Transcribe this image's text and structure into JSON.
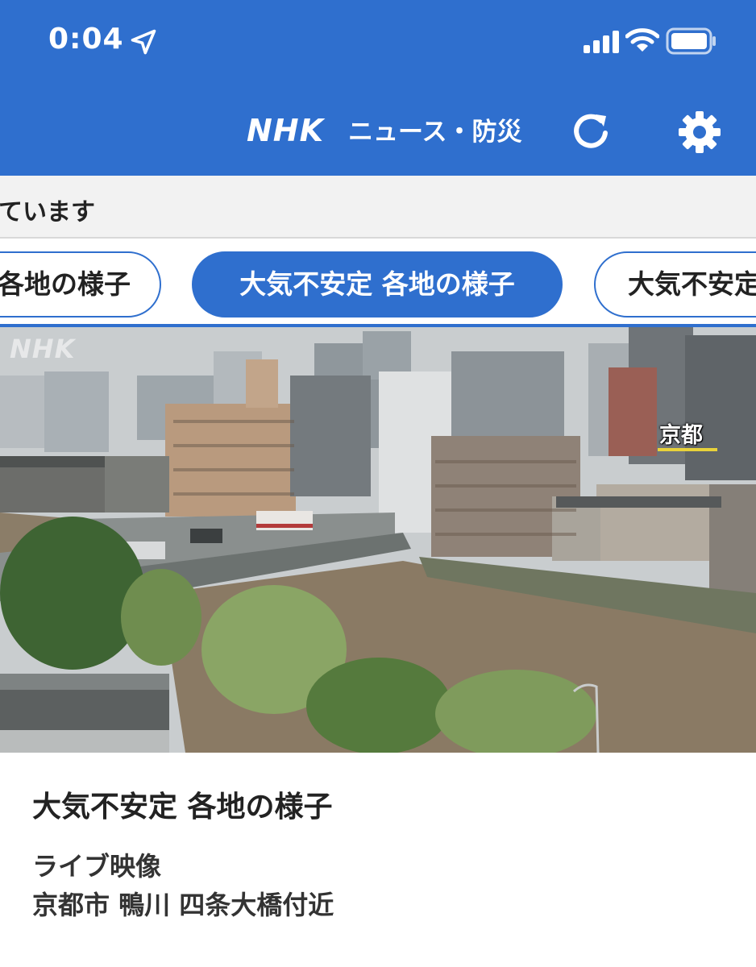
{
  "status_bar": {
    "time": "0:04",
    "icons": [
      "location-arrow-icon",
      "cellular-signal-icon",
      "wifi-icon",
      "battery-icon"
    ]
  },
  "app_header": {
    "brand": "NHK",
    "title": "ニュース・防災",
    "actions": [
      "refresh-icon",
      "gear-icon"
    ],
    "background_color": "#2f6fce"
  },
  "ticker": {
    "text": "ています"
  },
  "tabs": [
    {
      "label": "各地の様子",
      "active": false
    },
    {
      "label": "大気不安定 各地の様子",
      "active": true
    },
    {
      "label": "大気不安定",
      "active": false
    }
  ],
  "video": {
    "watermark": "NHK",
    "location_label": "京都"
  },
  "article": {
    "title": "大気不安定 各地の様子",
    "subtitle": "ライブ映像",
    "location": "京都市 鴨川 四条大橋付近"
  }
}
